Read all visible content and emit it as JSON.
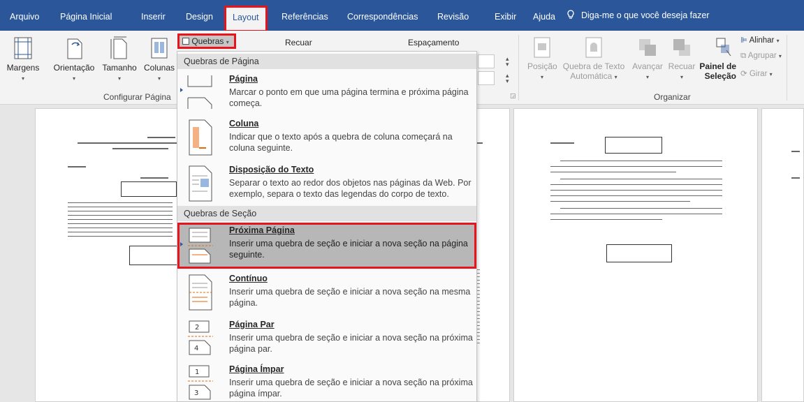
{
  "tabs": [
    "Arquivo",
    "Página Inicial",
    "Inserir",
    "Design",
    "Layout",
    "Referências",
    "Correspondências",
    "Revisão",
    "Exibir",
    "Ajuda"
  ],
  "active_tab": "Layout",
  "tell_me": "Diga-me o que você deseja fazer",
  "ribbon": {
    "page_setup": {
      "buttons": [
        "Margens",
        "Orientação",
        "Tamanho",
        "Colunas"
      ],
      "group_label": "Configurar Página"
    },
    "breaks_button": "Quebras",
    "indent_label": "Recuar",
    "spacing_label": "Espaçamento",
    "arrange": {
      "position": "Posição",
      "wrap_text_line1": "Quebra de Texto",
      "wrap_text_line2": "Automática",
      "bring_forward": "Avançar",
      "send_backward": "Recuar",
      "selection_pane_line1": "Painel de",
      "selection_pane_line2": "Seleção",
      "align": "Alinhar",
      "group": "Agrupar",
      "rotate": "Girar",
      "group_label": "Organizar"
    }
  },
  "menu": {
    "section_page": "Quebras de Página",
    "section_section": "Quebras de Seção",
    "items": [
      {
        "title": "Página",
        "desc": "Marcar o ponto em que uma página termina e próxima página começa."
      },
      {
        "title": "Coluna",
        "desc": "Indicar que o texto após a quebra de coluna começará na coluna seguinte."
      },
      {
        "title": "Disposição do Texto",
        "desc": "Separar o texto ao redor dos objetos nas páginas da Web. Por exemplo, separa o texto das legendas do corpo de texto."
      },
      {
        "title": "Próxima Página",
        "desc": "Inserir uma quebra de seção e iniciar a nova seção na página seguinte."
      },
      {
        "title": "Contínuo",
        "desc": "Inserir uma quebra de seção e iniciar a nova seção na mesma página."
      },
      {
        "title": "Página Par",
        "desc": "Inserir uma quebra de seção e iniciar a nova seção na próxima página par."
      },
      {
        "title": "Página Ímpar",
        "desc": "Inserir uma quebra de seção e iniciar a nova seção na próxima página ímpar."
      }
    ],
    "highlighted_item": "Próxima Página"
  },
  "icons": {
    "tell_me": "lightbulb-icon",
    "margins": "margins-icon",
    "orientation": "orientation-icon",
    "size": "size-icon",
    "columns": "columns-icon",
    "page_break": "page-break-icon",
    "column_break": "column-break-icon",
    "text_wrapping": "text-wrapping-icon",
    "next_page": "next-page-section-icon",
    "continuous": "continuous-section-icon",
    "even_page": "even-page-section-icon",
    "odd_page": "odd-page-section-icon"
  },
  "colors": {
    "tabbar": "#2b579a",
    "highlight_border": "#e8141c",
    "ribbon_bg": "#f3f3f3",
    "menu_highlight": "#b7b7b7"
  }
}
